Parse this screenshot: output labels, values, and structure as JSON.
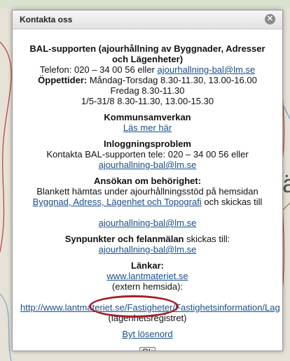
{
  "dialog": {
    "title": "Kontakta oss",
    "close_icon": "close-icon"
  },
  "support": {
    "heading": "BAL-supporten (ajourhållning av Byggnader, Adresser och Lägenheter)",
    "phone_prefix": "Telefon: 020 – 34 00 56 eller",
    "email": "ajourhallning-bal@lm.se",
    "hours_label": "Öppettider:",
    "hours_weekdays": "Måndag-Torsdag 8.30-11.30, 13.00-16.00",
    "hours_friday": "Fredag 8.30-11.30",
    "hours_summer": "1/5-31/8 8.30-11.30, 13.00-15.30"
  },
  "kommun": {
    "heading": "Kommunsamverkan",
    "link": "Läs mer här"
  },
  "login": {
    "heading": "Inloggningsproblem",
    "text": "Kontakta BAL-supporten tele: 020 – 34 00 56 eller",
    "email": "ajourhallning-bal@lm.se"
  },
  "apply": {
    "heading": "Ansökan om behörighet:",
    "text_start": "Blankett hämtas under ajourhållningsstöd på hemsidan",
    "link": "Byggnad, Adress, Lägenhet och Topografi",
    "text_end": "och skickas till",
    "email": "ajourhallning-bal@lm.se"
  },
  "feedback": {
    "heading": "Synpunkter och felanmälan",
    "text": "skickas till:",
    "email": "ajourhallning-bal@lm.se"
  },
  "links": {
    "heading": "Länkar:",
    "site": "www.lantmateriet.se",
    "site_note": "(extern hemsida):",
    "long_url": "http://www.lantmateriet.se/Fastigheter/Fastighetsinformation/Lag",
    "long_note": "(lägenhetsregistret)",
    "change_password": "Byt lösenord"
  },
  "ok_label": "Ok"
}
